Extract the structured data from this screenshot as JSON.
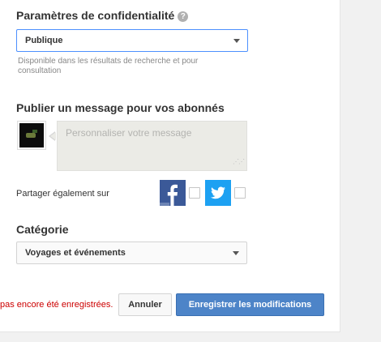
{
  "privacy": {
    "title": "Paramètres de confidentialité",
    "help_glyph": "?",
    "selected": "Publique",
    "hint": "Disponible dans les résultats de recherche et pour consultation"
  },
  "message": {
    "title": "Publier un message pour vos abonnés",
    "placeholder": "Personnaliser votre message"
  },
  "share": {
    "label": "Partager également sur"
  },
  "category": {
    "title": "Catégorie",
    "selected": "Voyages et événements"
  },
  "footer": {
    "unsaved_text": "pas encore été enregistrées.",
    "cancel_label": "Annuler",
    "save_label": "Enregistrer les modifications"
  },
  "colors": {
    "facebook": "#3b5998",
    "twitter": "#1da1f2",
    "primary_button": "#4d84c8",
    "warning_text": "#cc0000"
  }
}
